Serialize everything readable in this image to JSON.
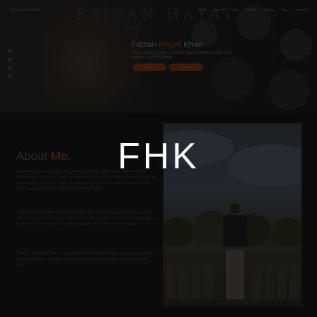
{
  "hero": {
    "logo": "FHK | FaizanHayatKhan",
    "nav": [
      "Home",
      "About Me",
      "Skills",
      "Services",
      "Portfolio",
      "Blog",
      "Contact Me"
    ],
    "bg_text_1": "FAIZAN HAYAT",
    "bg_text_2": "KHAN",
    "name_first": "Faizan",
    "name_middle": "Hayat",
    "name_last": "Khan",
    "subtitle": "Erasmus Mundus Scholar | Content & Digital Marketing Specialist | Data Visualiser | Cricket Enthusiast",
    "about_button": "About Me",
    "contact_button": "Contact Me"
  },
  "about": {
    "title_main": "About",
    "title_accent": "Me.",
    "paragraph_1": "Welcome to my website! I'm Faizan Hayat, and I'm a passionate digital marketer, content and digital marketing specialist, and data visualiser who loves telling stories with data. With experience, I am dedicated to helping others improve their careers and building brands. My aim is to use the information I learn to create insights and data-driven strategies that contribute to growth.",
    "paragraph_2": "I leverage my diverse portfolio to lead digital transformation, implementing tailored digital strategies and data-driven campaigns that create real and measurable outcomes. When I am not working, I enjoy writing blogs, connecting with new people, spending time outdoors and playing cricket on weekends.",
    "paragraph_3": "Thank you for visiting my website. I hope you find it informative and engaging. If you have any questions or would like to learn more about how I can help you with your next project, please don't hesitate to get in touch."
  },
  "splash": {
    "text": "FHK"
  },
  "colors": {
    "accent": "#e8491d",
    "background": "#0b0b0b",
    "splash_text": "#ffffff"
  }
}
